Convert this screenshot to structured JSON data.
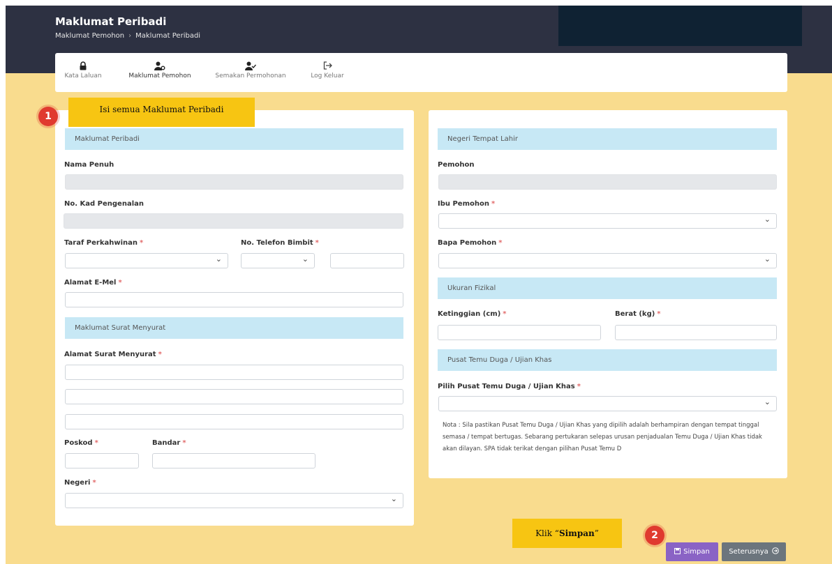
{
  "header": {
    "title": "Maklumat Peribadi",
    "breadcrumb": [
      "Maklumat Pemohon",
      "Maklumat Peribadi"
    ],
    "breadcrumb_sep": "›"
  },
  "nav": [
    {
      "label": "Kata Laluan",
      "icon": "lock-icon",
      "glyph": "🔒"
    },
    {
      "label": "Maklumat Pemohon",
      "icon": "user-cog-icon",
      "glyph": "👤"
    },
    {
      "label": "Semakan Permohonan",
      "icon": "user-check-icon",
      "glyph": "👤"
    },
    {
      "label": "Log Keluar",
      "icon": "sign-out-icon",
      "glyph": "➜"
    }
  ],
  "callouts": {
    "step1_num": "1",
    "step1_text": "Isi semua Maklumat Peribadi",
    "step2_num": "2",
    "step2_prefix": "Klik “",
    "step2_bold": "Simpan",
    "step2_suffix": "”"
  },
  "left": {
    "section_personal": "Maklumat Peribadi",
    "nama_penuh": "Nama Penuh",
    "no_kad": "No. Kad Pengenalan",
    "taraf": "Taraf Perkahwinan",
    "telefon": "No. Telefon Bimbit",
    "emel": "Alamat E-Mel",
    "section_surat": "Maklumat Surat Menyurat",
    "alamat": "Alamat Surat Menyurat",
    "poskod": "Poskod",
    "bandar": "Bandar",
    "negeri": "Negeri"
  },
  "right": {
    "section_lahir": "Negeri Tempat Lahir",
    "pemohon": "Pemohon",
    "ibu": "Ibu Pemohon",
    "bapa": "Bapa Pemohon",
    "section_fizikal": "Ukuran Fizikal",
    "tinggi": "Ketinggian (cm)",
    "berat": "Berat (kg)",
    "section_pusat": "Pusat Temu Duga / Ujian Khas",
    "pilih_pusat": "Pilih Pusat Temu Duga / Ujian Khas",
    "nota": "Nota : Sila pastikan Pusat Temu Duga / Ujian Khas yang dipilih adalah berhampiran dengan tempat tinggal semasa / tempat bertugas. Sebarang pertukaran selepas urusan penjadualan Temu Duga / Ujian Khas tidak akan dilayan. SPA tidak terikat dengan pilihan Pusat Temu D"
  },
  "buttons": {
    "simpan": "Simpan",
    "seterusnya": "Seterusnya"
  },
  "colors": {
    "header": "#2d3142",
    "background": "#f9dc8e",
    "section": "#c7e8f5",
    "callout": "#f7c512",
    "badge": "#e03a2f",
    "simpan": "#8a63c5",
    "seterusnya": "#6c757d"
  }
}
